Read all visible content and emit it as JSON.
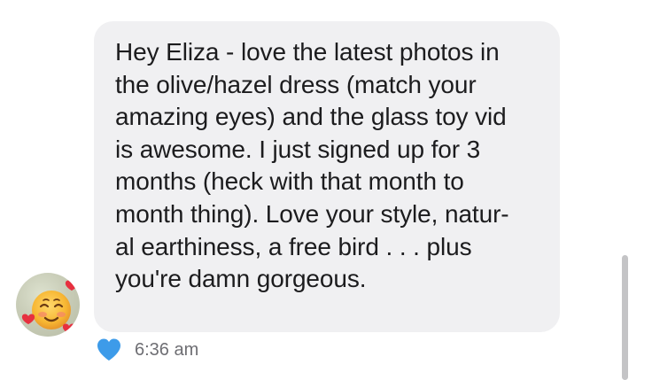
{
  "message": {
    "lines": [
      "Hey Eliza - love the latest photos in",
      "the olive/hazel dress (match your",
      "amazing eyes) and the glass toy vid",
      "is awesome. I just signed up for 3",
      "months (heck with that month to",
      "month thing). Love your style, natur-",
      "al earthiness, a free bird . . . plus",
      "you're damn gorgeous."
    ],
    "timestamp": "6:36 am",
    "reaction_icon": "blue-heart-icon",
    "avatar_icon": "smiling-face-with-hearts-icon"
  },
  "colors": {
    "bubble": "#f0f0f2",
    "text": "#1c1c1e",
    "timestamp": "#6e6e73",
    "reaction": "#3d9be9"
  }
}
